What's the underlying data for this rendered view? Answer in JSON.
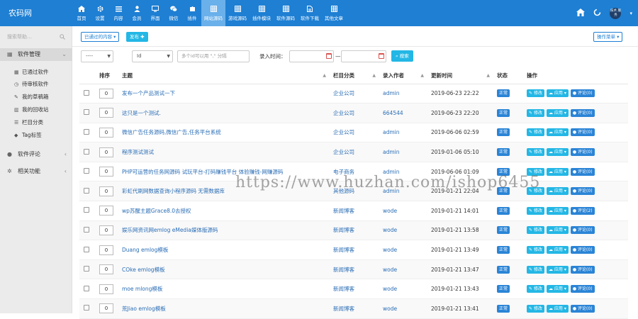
{
  "app": {
    "logo": "农码网"
  },
  "nav": [
    {
      "label": "首页",
      "icon": "home-icon"
    },
    {
      "label": "设置",
      "icon": "gear-icon"
    },
    {
      "label": "内容",
      "icon": "list-icon"
    },
    {
      "label": "会员",
      "icon": "user-icon"
    },
    {
      "label": "界面",
      "icon": "monitor-icon"
    },
    {
      "label": "微信",
      "icon": "wechat-icon"
    },
    {
      "label": "插件",
      "icon": "puzzle-icon"
    },
    {
      "label": "网站源码",
      "icon": "table-icon",
      "active": true
    },
    {
      "label": "游戏源码",
      "icon": "table-icon"
    },
    {
      "label": "插件模块",
      "icon": "table-icon"
    },
    {
      "label": "软件源码",
      "icon": "table-icon"
    },
    {
      "label": "软件下载",
      "icon": "file-icon"
    },
    {
      "label": "其他文章",
      "icon": "table-icon"
    }
  ],
  "topright": {
    "avatar_text": "技术 服务"
  },
  "sidebar": {
    "search_placeholder": "搜索帮助…",
    "group_main": "软件管理",
    "items": [
      "已通过软件",
      "待审核软件",
      "我的草稿箱",
      "我的回收站",
      "栏目分类",
      "Tag标签"
    ],
    "group_comment": "软件评论",
    "group_related": "相关功能"
  },
  "toolbar": {
    "status_btn": "已通过的内容",
    "publish_btn": "发布",
    "ops_btn": "操作菜单"
  },
  "filter": {
    "sel1": "----",
    "sel2": "Id",
    "id_placeholder": "多个id可以用 \",\" 分隔",
    "time_label": "录入时间：",
    "dash": "—",
    "search_btn": "搜索"
  },
  "table": {
    "headers": [
      "排序",
      "主题",
      "栏目分类",
      "录入作者",
      "更新时间",
      "状态",
      "操作"
    ],
    "status_label": "正常",
    "edit_label": "修改",
    "apply_label": "应用",
    "comment_prefix": "评论",
    "rows": [
      {
        "order": "0",
        "title": "发布一个产品测试一下",
        "cat": "企业公司",
        "author": "admin",
        "time": "2019-06-23 22:22",
        "comments": "(0)"
      },
      {
        "order": "0",
        "title": "这只是一个测试.",
        "cat": "企业公司",
        "author": "664544",
        "time": "2019-06-23 22:20",
        "comments": "(0)"
      },
      {
        "order": "0",
        "title": "微信广告任务源码,微信广告,任务平台系统",
        "cat": "企业公司",
        "author": "admin",
        "time": "2019-06-06 02:59",
        "comments": "(0)"
      },
      {
        "order": "0",
        "title": "程序测试测试",
        "cat": "企业公司",
        "author": "admin",
        "time": "2019-01-06 05:10",
        "comments": "(0)"
      },
      {
        "order": "0",
        "title": "PHP可运营的任务网源码 试玩平台-打码赚钱平台 体验赚钱-网赚源码",
        "cat": "电子商务",
        "author": "admin",
        "time": "2019-06-06 01:09",
        "comments": "(0)"
      },
      {
        "order": "0",
        "title": "彩虹代刷网数据查询小程序源码 无需数据库",
        "cat": "其他源码",
        "author": "admin",
        "time": "2019-01-21 22:04",
        "comments": "(0)"
      },
      {
        "order": "0",
        "title": "wp苏醒主题Grace8.0去授权",
        "cat": "新闻博客",
        "author": "wode",
        "time": "2019-01-21 14:01",
        "comments": "(2)"
      },
      {
        "order": "0",
        "title": "娱乐网资讯网emlog eMedia媒体版源码",
        "cat": "新闻博客",
        "author": "wode",
        "time": "2019-01-21 13:58",
        "comments": "(0)"
      },
      {
        "order": "0",
        "title": "Duang emlog模板",
        "cat": "新闻博客",
        "author": "wode",
        "time": "2019-01-21 13:49",
        "comments": "(0)"
      },
      {
        "order": "0",
        "title": "COke emlog模板",
        "cat": "新闻博客",
        "author": "wode",
        "time": "2019-01-21 13:47",
        "comments": "(0)"
      },
      {
        "order": "0",
        "title": "moe mlong模板",
        "cat": "新闻博客",
        "author": "wode",
        "time": "2019-01-21 13:43",
        "comments": "(0)"
      },
      {
        "order": "0",
        "title": "荒Jiao emlog模板",
        "cat": "新闻博客",
        "author": "wode",
        "time": "2019-01-21 13:41",
        "comments": "(0)"
      }
    ]
  },
  "watermark": "https://www.huzhan.com/ishop6455",
  "colors": {
    "topbar": "#1e7fd3",
    "active_nav": "#6ab0ea",
    "button": "#23b7e5",
    "status": "#2a84d6"
  }
}
